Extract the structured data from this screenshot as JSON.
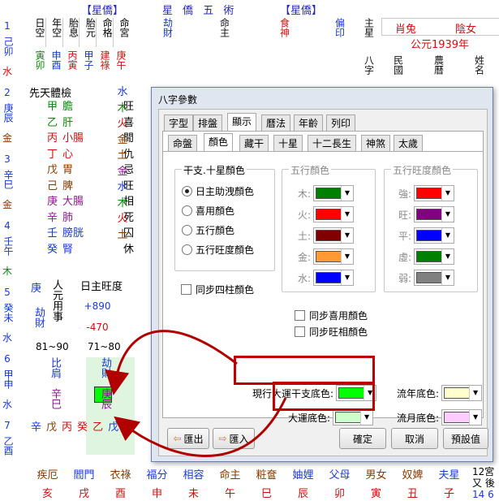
{
  "header": {
    "left_tag": "【星僑】",
    "title": "星 僑 五 術",
    "right_tag": "【星僑】",
    "gods": [
      "劫財",
      "命主",
      "食神",
      "偏印"
    ],
    "zhu_xing": "主星",
    "zodiac": "肖兔",
    "gender": "陰女",
    "year": "公元1939年",
    "ba_zi_label": "八字",
    "min_guo": "民國",
    "nong_li": "農曆",
    "xing_ming": "姓名"
  },
  "left_table": {
    "head": [
      "日空",
      "年空",
      "胎息",
      "胎元",
      "命格",
      "命宮"
    ],
    "row2": [
      "寅卯",
      "申酉",
      "丙寅",
      "甲子",
      "建祿",
      "庚午"
    ],
    "xian_tian": "先天體檢",
    "organs": [
      [
        "甲",
        "膽"
      ],
      [
        "乙",
        "肝"
      ],
      [
        "丙",
        "小腸"
      ],
      [
        "丁",
        "心"
      ],
      [
        "戊",
        "胃"
      ],
      [
        "己",
        "脾"
      ],
      [
        "庚",
        "大腸"
      ],
      [
        "辛",
        "肺"
      ],
      [
        "壬",
        "膀胱"
      ],
      [
        "癸",
        "腎"
      ]
    ],
    "states": [
      "旺",
      "喜",
      "閒",
      "仇",
      "忌",
      "旺",
      "相",
      "死",
      "囚",
      "休"
    ],
    "elements": [
      "水",
      "木",
      "火",
      "金",
      "土",
      "金",
      "水",
      "木",
      "火",
      "土"
    ],
    "ri_zhu": "日主旺度",
    "vals": [
      "+890",
      "-470"
    ],
    "lower_left": [
      "庚",
      "劫財",
      "人元用事"
    ]
  },
  "far_left_col": {
    "nums": [
      "1",
      "己卯",
      "2",
      "庚辰",
      "3",
      "辛巳",
      "4",
      "壬午",
      "5",
      "癸未",
      "6",
      "甲申",
      "7",
      "乙酉"
    ],
    "elements": [
      "水",
      "金",
      "金",
      "木",
      "水",
      "水",
      "水",
      "木"
    ]
  },
  "luck": {
    "ranges": [
      "81~90",
      "71~80"
    ],
    "gods": [
      "比肩",
      "劫財"
    ],
    "stem_branch": [
      "辛巳",
      "庚辰"
    ],
    "ten_gods": [
      "辛",
      "戊",
      "丙",
      "癸",
      "乙",
      "戊"
    ]
  },
  "bottom_row": [
    "疾厄",
    "閻門",
    "衣祿",
    "福分",
    "相容",
    "命主",
    "粧奩",
    "妯娌",
    "父母",
    "男女",
    "奴婢",
    "夫星"
  ],
  "bottom_row2": [
    "亥",
    "戌",
    "酉",
    "申",
    "未",
    "午",
    "巳",
    "辰",
    "卯",
    "寅",
    "丑",
    "子"
  ],
  "bottom_right": [
    "12宮",
    "又",
    "後",
    "14",
    "6"
  ],
  "dialog": {
    "title": "八字參數",
    "tabs_top": [
      "字型",
      "排盤",
      "顯示",
      "曆法",
      "年齡",
      "列印"
    ],
    "tabs_sub": [
      "命盤",
      "顏色",
      "藏干",
      "十星",
      "十二長生",
      "神煞",
      "太歲"
    ],
    "group1_title": "干支.十星顏色",
    "radios": [
      "日主助洩顏色",
      "喜用顏色",
      "五行顏色",
      "五行旺度顏色"
    ],
    "sync_four": "同步四柱顏色",
    "group2_title": "五行顏色",
    "wuxing": [
      {
        "label": "木:",
        "color": "#008000"
      },
      {
        "label": "火:",
        "color": "#ff0000"
      },
      {
        "label": "土:",
        "color": "#800000"
      },
      {
        "label": "金:",
        "color": "#ff9933"
      },
      {
        "label": "水:",
        "color": "#0000ff"
      }
    ],
    "sync_xiyong": "同步喜用顏色",
    "sync_wang": "同步旺相顏色",
    "group3_title": "五行旺度顏色",
    "wangdu": [
      {
        "label": "強:",
        "color": "#ff0000"
      },
      {
        "label": "旺:",
        "color": "#800080"
      },
      {
        "label": "平:",
        "color": "#0000ff"
      },
      {
        "label": "虛:",
        "color": "#008000"
      },
      {
        "label": "弱:",
        "color": "#808080"
      }
    ],
    "current_luck_label": "現行大運干支底色:",
    "current_luck_color": "#00ff00",
    "luck_bg_label": "大運底色:",
    "luck_bg_color": "#ccffcc",
    "year_bg_label": "流年底色:",
    "year_bg_color": "#ffffcc",
    "month_bg_label": "流月底色:",
    "month_bg_color": "#ffccff",
    "buttons": {
      "export": "匯出",
      "import": "匯入",
      "ok": "確定",
      "cancel": "取消",
      "default": "預設值"
    }
  }
}
